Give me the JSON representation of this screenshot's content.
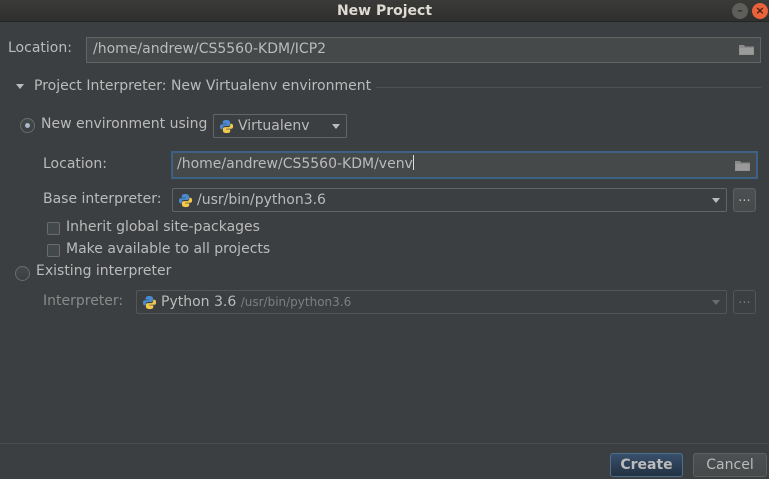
{
  "window": {
    "title": "New Project"
  },
  "location": {
    "label": "Location:",
    "value": "/home/andrew/CS5560-KDM/ICP2"
  },
  "interpreter_section": {
    "title": "Project Interpreter: New Virtualenv environment"
  },
  "new_env": {
    "radio_label": "New environment using",
    "selected": true,
    "tool": "Virtualenv",
    "location_label": "Location:",
    "location_value": "/home/andrew/CS5560-KDM/venv",
    "base_label": "Base interpreter:",
    "base_value": "/usr/bin/python3.6",
    "inherit_label": "Inherit global site-packages",
    "inherit_checked": false,
    "available_label": "Make available to all projects",
    "available_checked": false
  },
  "existing_env": {
    "radio_label": "Existing interpreter",
    "selected": false,
    "interpreter_label": "Interpreter:",
    "interpreter_name": "Python 3.6",
    "interpreter_path": "/usr/bin/python3.6"
  },
  "buttons": {
    "create": "Create",
    "cancel": "Cancel",
    "browse": "..."
  },
  "colors": {
    "background": "#3c3f41",
    "accent": "#3d6185",
    "text": "#bbbbbb"
  },
  "icons": [
    "folder-icon",
    "python-icon",
    "close-icon",
    "minimize-icon"
  ]
}
